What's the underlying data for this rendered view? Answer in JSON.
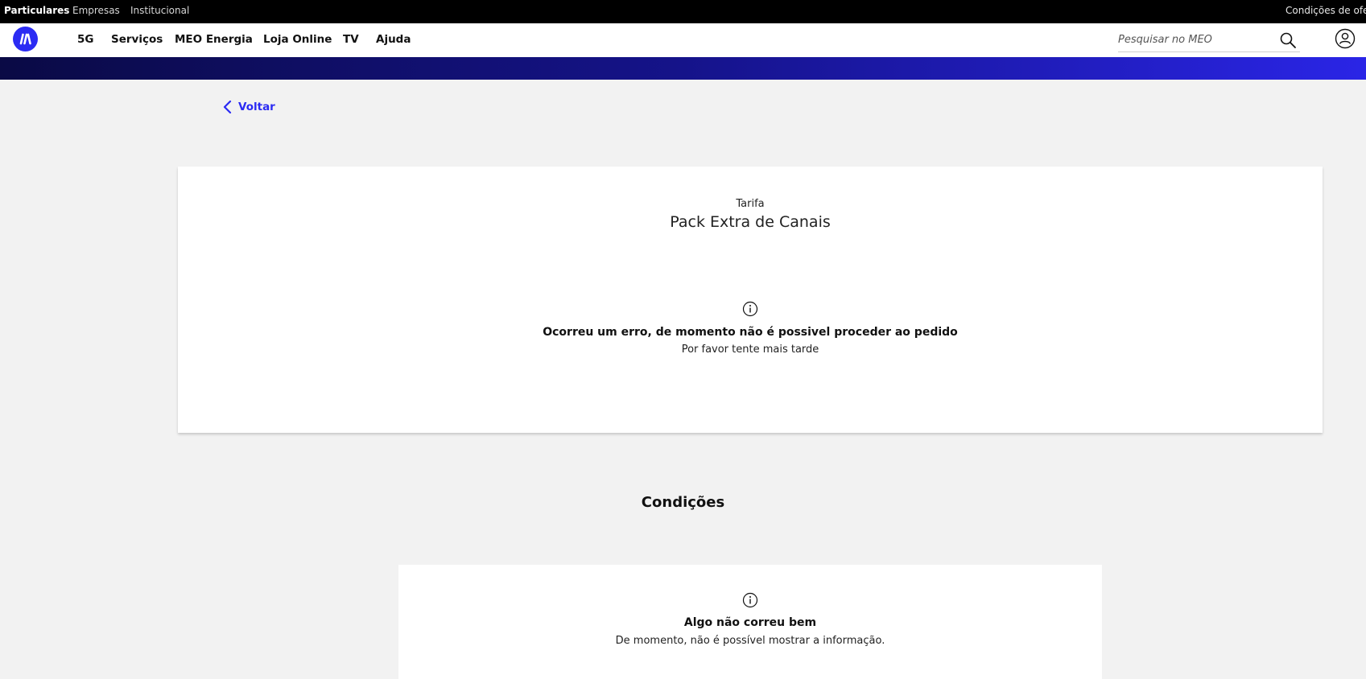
{
  "topbar": {
    "segments": [
      "Particulares",
      "Empresas",
      "Institucional"
    ],
    "right_link": "Condições de ofert"
  },
  "nav": {
    "items": [
      "5G",
      "Serviços",
      "MEO Energia",
      "Loja Online",
      "TV",
      "Ajuda"
    ],
    "search_placeholder": "Pesquisar no MEO",
    "brand_color": "#2b2bf3"
  },
  "back": {
    "label": "Voltar"
  },
  "tariff_card": {
    "label": "Tarifa",
    "name": "Pack Extra de Canais",
    "error_title": "Ocorreu um erro, de momento não é possivel proceder ao pedido",
    "error_sub": "Por favor tente mais tarde"
  },
  "conditions": {
    "title": "Condições",
    "error_title": "Algo não correu bem",
    "error_sub": "De momento, não é possível mostrar a informação."
  }
}
